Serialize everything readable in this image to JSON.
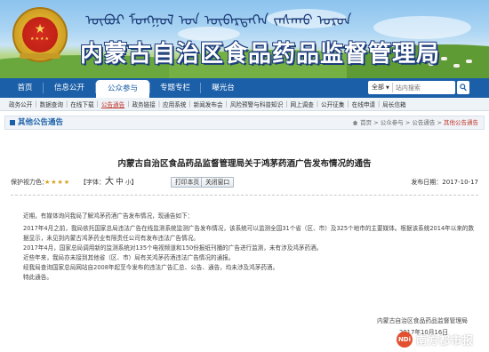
{
  "header": {
    "mongolian_text": "ᠥᠪᠥᠷ ᠮᠣᠩᠭᠣᠯ ᠤᠨ ᠥᠪᠡᠷᠲᠡᠭᠡᠨ ᠵᠠᠰᠠᠬᠤ ᠣᠷᠣᠨ",
    "site_title": "内蒙古自治区食品药品监督管理局",
    "colors": {
      "nav_blue": "#1b5fa8",
      "title_outline": "#1d3d7c"
    }
  },
  "main_nav": {
    "items": [
      {
        "label": "首页",
        "active": false
      },
      {
        "label": "信息公开",
        "active": false
      },
      {
        "label": "公众参与",
        "active": true
      },
      {
        "label": "专题专栏",
        "active": false
      },
      {
        "label": "曝光台",
        "active": false
      }
    ],
    "search": {
      "scope": "全部",
      "placeholder": "站内搜索"
    }
  },
  "sub_nav": {
    "items": [
      {
        "label": "政务公开",
        "current": false
      },
      {
        "label": "数据查询",
        "current": false
      },
      {
        "label": "在线下载",
        "current": false
      },
      {
        "label": "公告通告",
        "current": true
      },
      {
        "label": "政务链接",
        "current": false
      },
      {
        "label": "应用系统",
        "current": false
      },
      {
        "label": "新闻发布会",
        "current": false
      },
      {
        "label": "风险预警与科普知识",
        "current": false
      },
      {
        "label": "网上调查",
        "current": false
      },
      {
        "label": "公开征集",
        "current": false
      },
      {
        "label": "在线申请",
        "current": false
      },
      {
        "label": "局长信箱",
        "current": false
      }
    ]
  },
  "section": {
    "title": "其他公告通告",
    "breadcrumb": {
      "home": "首页",
      "sep": ">",
      "level1": "公众参与",
      "level2": "公告通告",
      "current": "其他公告通告"
    }
  },
  "article": {
    "title": "内蒙古自治区食品药品监督管理局关于鸿茅药酒广告发布情况的通告",
    "protect_label": "保护视力色：",
    "font_label": "【字体：",
    "font_big": "大",
    "font_mid": "中",
    "font_small": "小",
    "font_close": "】",
    "print_button": "打印本页",
    "close_button": "关闭窗口",
    "publish_time": "发布日期：2017-10-17",
    "paragraphs": [
      "近期，有媒体询问我局了解鸿茅药酒广告发布情况，现通告如下：",
      "2017年4月之前，我局依托国家总局违法广告在线监测系统监测广告发布情况，该系统可以监测全国31个省（区、市）及325个地市的主要媒体。根据该系统2014年以来的数据显示，未见到内蒙古鸿茅药业有限责任公司有发布违法广告情况。",
      "2017年4月，国家总局调用新的监测系统对135个电视频道和150份报纸刊播的广告进行监测，未有涉及鸿茅药酒。",
      "近些年来，我局亦未接到其他省（区、市）局有关鸿茅药酒违法广告情况的通报。",
      "经我局查询国家总局网站自2008年起至今发布的违法广告汇总、公告、通告，均未涉及鸿茅药酒。",
      "特此通告。"
    ],
    "signature": "内蒙古自治区食品药品监督管理局",
    "signature_date": "2017年10月16日"
  },
  "watermark": {
    "logo": "NDi",
    "text": "南方都市报"
  }
}
